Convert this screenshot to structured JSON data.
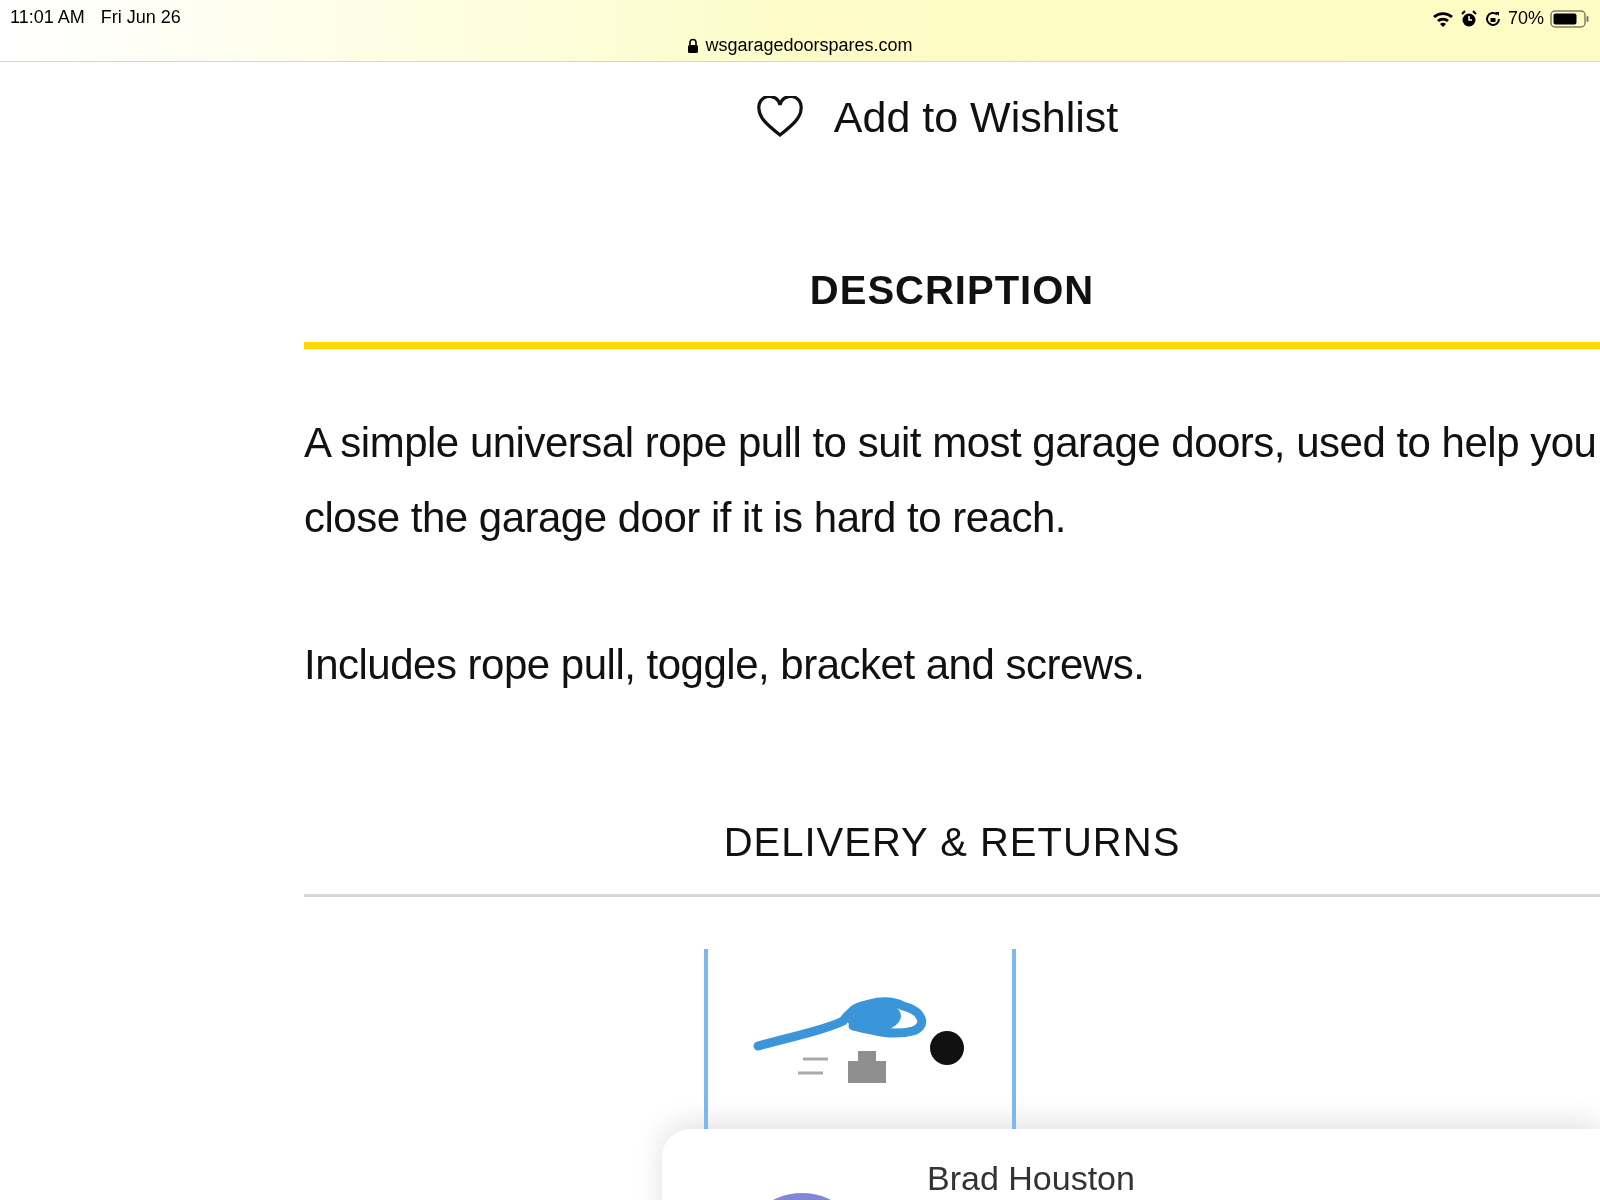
{
  "status_bar": {
    "time": "11:01 AM",
    "date": "Fri Jun 26",
    "url": "wsgaragedoorspares.com",
    "battery": "70%"
  },
  "wishlist": {
    "label": "Add to Wishlist"
  },
  "tabs": [
    {
      "label": "DESCRIPTION",
      "selected": true
    },
    {
      "label": "DELIVERY & RETURNS",
      "selected": false
    }
  ],
  "description": [
    "A simple universal rope pull to suit most garage doors, used to help you close the garage door if it is hard to reach.",
    "Includes rope pull, toggle, bracket and screws."
  ],
  "review_card": {
    "name": "Brad Houston"
  }
}
